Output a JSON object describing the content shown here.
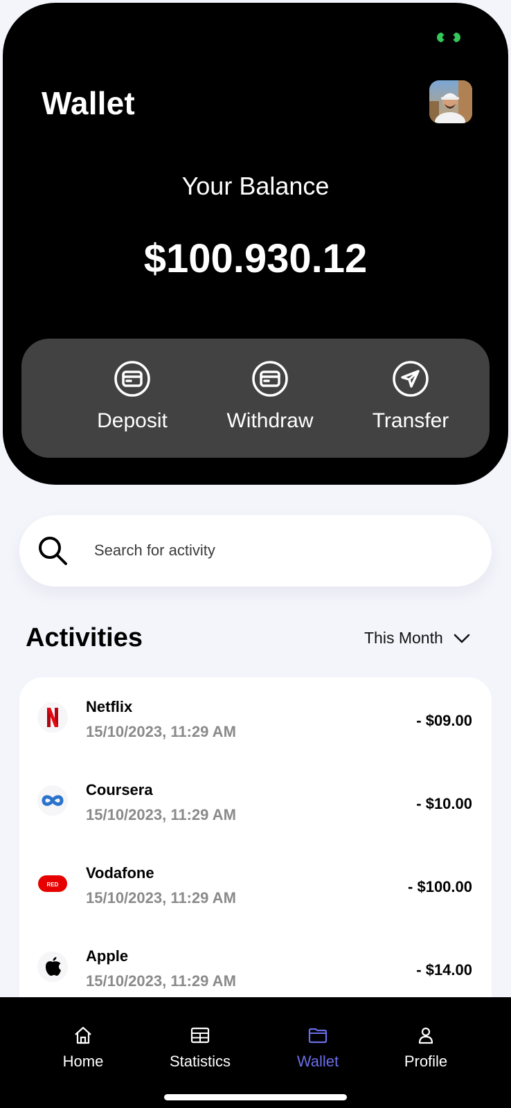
{
  "header": {
    "title": "Wallet",
    "balance_label": "Your Balance",
    "balance_amount": "$100.930.12",
    "status_color": "#34c759"
  },
  "actions": [
    {
      "label": "Deposit",
      "icon": "card-icon"
    },
    {
      "label": "Withdraw",
      "icon": "card-icon"
    },
    {
      "label": "Transfer",
      "icon": "send-icon"
    }
  ],
  "search": {
    "placeholder": "Search for activity",
    "value": ""
  },
  "activities": {
    "title": "Activities",
    "period": "This Month",
    "items": [
      {
        "name": "Netflix",
        "date": "15/10/2023, 11:29 AM",
        "amount": "- $09.00",
        "logo": "netflix-logo"
      },
      {
        "name": "Coursera",
        "date": "15/10/2023, 11:29 AM",
        "amount": "- $10.00",
        "logo": "coursera-logo"
      },
      {
        "name": "Vodafone",
        "date": "15/10/2023, 11:29 AM",
        "amount": "- $100.00",
        "logo": "vodafone-logo"
      },
      {
        "name": "Apple",
        "date": "15/10/2023, 11:29 AM",
        "amount": "- $14.00",
        "logo": "apple-logo"
      }
    ],
    "vodafone_badge_text": "RED"
  },
  "nav": {
    "items": [
      {
        "label": "Home",
        "icon": "home-icon",
        "active": false
      },
      {
        "label": "Statistics",
        "icon": "table-icon",
        "active": false
      },
      {
        "label": "Wallet",
        "icon": "folder-icon",
        "active": true
      },
      {
        "label": "Profile",
        "icon": "user-icon",
        "active": false
      }
    ],
    "active_color": "#6b6ee8"
  }
}
